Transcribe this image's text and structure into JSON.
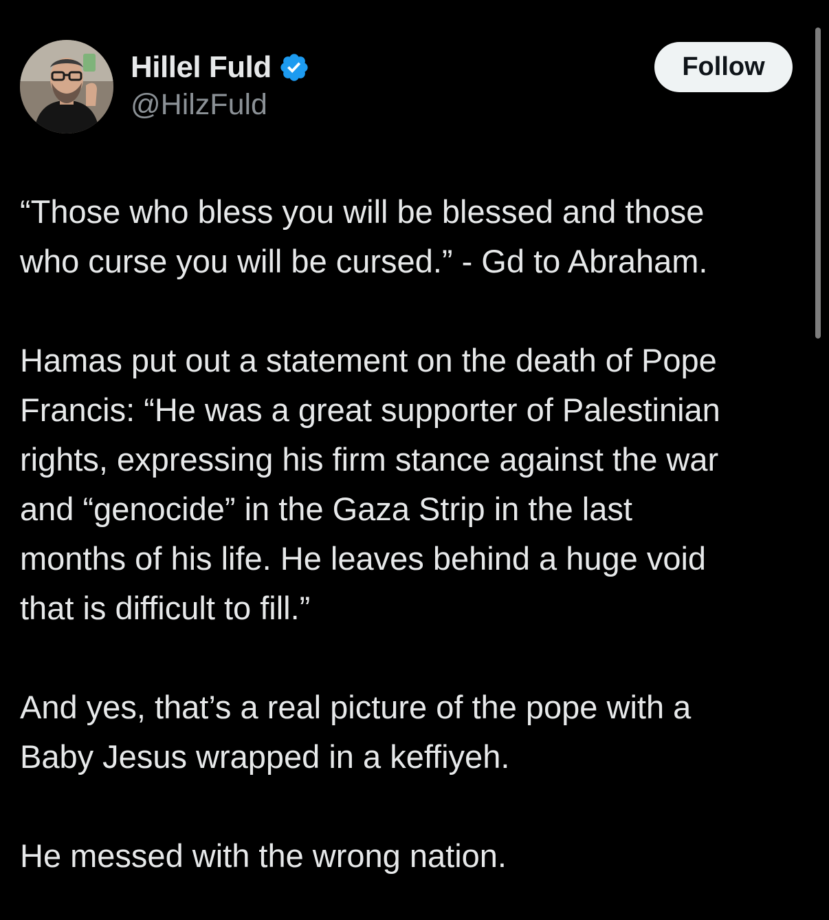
{
  "author": {
    "display_name": "Hillel Fuld",
    "handle": "@HilzFuld",
    "avatar_icon": "avatar-photo",
    "verified_icon": "verified-badge-icon",
    "verified_color": "#1d9bf0"
  },
  "actions": {
    "follow_label": "Follow"
  },
  "tweet": {
    "paragraphs": [
      "“Those who bless you will be blessed and those\nwho curse you will be cursed.” - Gd to Abraham.",
      "Hamas put out a statement on the death of Pope\nFrancis: “He was a great supporter of Palestinian\nrights, expressing his firm stance against the war\nand “genocide” in the Gaza Strip in the last\nmonths of his life. He leaves behind a huge void\nthat is difficult to fill.”",
      "And yes, that’s a real picture of the pope with a\nBaby Jesus wrapped in a keffiyeh.",
      "He messed with the wrong nation."
    ]
  },
  "colors": {
    "background": "#000000",
    "text": "#e7e9ea",
    "secondary_text": "#8b9196",
    "follow_button_bg": "#eff3f4",
    "follow_button_text": "#0f1419"
  }
}
